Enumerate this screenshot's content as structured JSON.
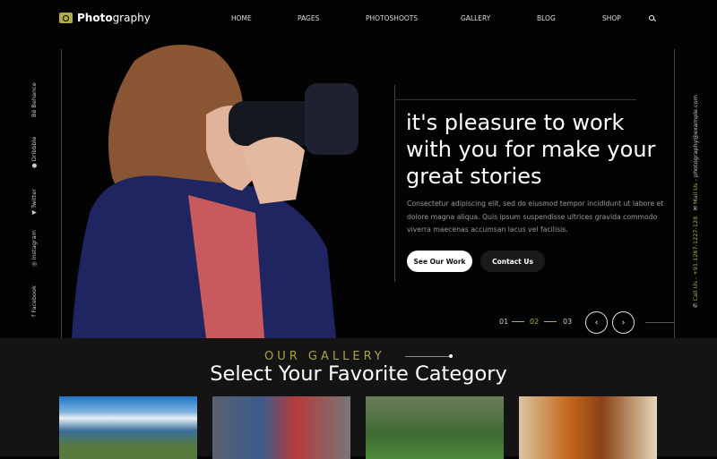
{
  "brand": {
    "bold": "Photo",
    "light": "graphy"
  },
  "nav": [
    "HOME",
    "PAGES",
    "PHOTOSHOOTS",
    "GALLERY",
    "BLOG",
    "SHOP"
  ],
  "social": [
    "Behance",
    "Dribbble",
    "Twitter",
    "Instagram",
    "Facebook"
  ],
  "contact": {
    "call": "Call Us - +91 1267-1227-128",
    "mail_label": "Mail Us - ",
    "mail": "photography@example.com"
  },
  "hero": {
    "title": "it's pleasure to work with you for make your great stories",
    "description": "Consectetur adipiscing elit, sed do eiusmod tempor incididunt ut labore et dolore magna aliqua. Quis ipsum suspendisse ultrices gravida  commodo viverra maecenas accumsan lacus vel facilisis.",
    "primary_button": "See Our Work",
    "secondary_button": "Contact Us"
  },
  "slider": {
    "pages": [
      "01",
      "02",
      "03"
    ],
    "active": "02",
    "prev": "‹",
    "next": "›"
  },
  "gallery": {
    "eyebrow": "OUR GALLERY",
    "title": "Select Your Favorite Category"
  },
  "colors": {
    "accent": "#b1a94e",
    "background": "#030303",
    "section": "#141414"
  }
}
